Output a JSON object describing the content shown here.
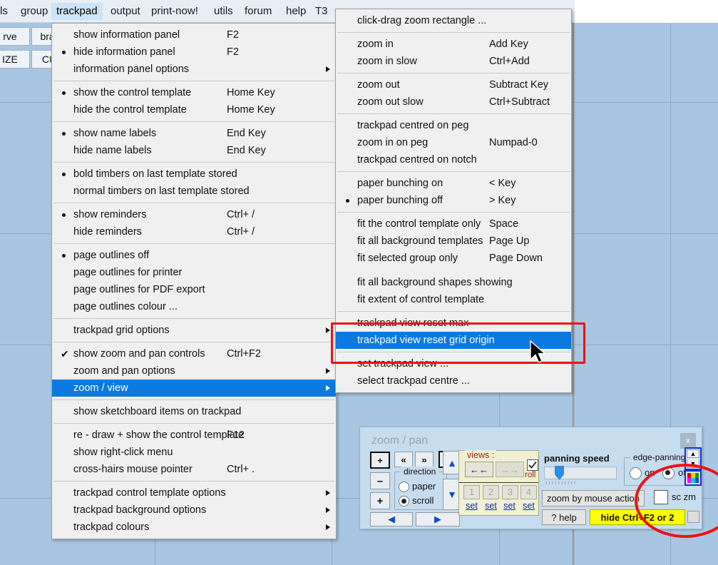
{
  "app": {
    "background_color": "#a8c6e2",
    "grid_line_color": "#8aa9c4"
  },
  "menubar": {
    "items": [
      {
        "label": "ls",
        "active": false
      },
      {
        "label": "group",
        "active": false
      },
      {
        "label": "trackpad",
        "active": true
      },
      {
        "label": "output",
        "active": false
      },
      {
        "label": "print-now!",
        "active": false
      },
      {
        "label": "utils",
        "active": false
      },
      {
        "label": "forum",
        "active": false
      },
      {
        "label": "help",
        "active": false
      },
      {
        "label": "T3",
        "active": false
      }
    ]
  },
  "toolbar": {
    "buttons": [
      {
        "label": "rve"
      },
      {
        "label": "branc"
      },
      {
        "label": "IZE"
      },
      {
        "label": "CUR"
      }
    ]
  },
  "trackpad_menu": {
    "title": "trackpad",
    "items": [
      {
        "type": "item",
        "label": "show information panel",
        "accel": "F2"
      },
      {
        "type": "item",
        "label": "hide information panel",
        "accel": "F2",
        "bullet": true
      },
      {
        "type": "item",
        "label": "information panel options",
        "accel": "",
        "submenu": true
      },
      {
        "type": "sep"
      },
      {
        "type": "item",
        "label": "show the control template",
        "accel": "Home Key",
        "bullet": true
      },
      {
        "type": "item",
        "label": "hide the control template",
        "accel": "Home Key"
      },
      {
        "type": "sep"
      },
      {
        "type": "item",
        "label": "show name labels",
        "accel": "End Key",
        "bullet": true
      },
      {
        "type": "item",
        "label": "hide name labels",
        "accel": "End Key"
      },
      {
        "type": "sep"
      },
      {
        "type": "item",
        "label": "bold timbers on last template stored",
        "accel": "",
        "bullet": true
      },
      {
        "type": "item",
        "label": "normal timbers on last template stored",
        "accel": ""
      },
      {
        "type": "sep"
      },
      {
        "type": "item",
        "label": "show reminders",
        "accel": "Ctrl+ /",
        "bullet": true
      },
      {
        "type": "item",
        "label": "hide reminders",
        "accel": "Ctrl+ /"
      },
      {
        "type": "sep"
      },
      {
        "type": "item",
        "label": "page outlines off",
        "accel": "",
        "bullet": true
      },
      {
        "type": "item",
        "label": "page outlines for printer",
        "accel": ""
      },
      {
        "type": "item",
        "label": "page outlines for PDF export",
        "accel": ""
      },
      {
        "type": "item",
        "label": "page outlines colour ...",
        "accel": ""
      },
      {
        "type": "sep"
      },
      {
        "type": "item",
        "label": "trackpad grid options",
        "accel": "",
        "submenu": true
      },
      {
        "type": "sep"
      },
      {
        "type": "item",
        "label": "show zoom and pan controls",
        "accel": "Ctrl+F2",
        "check": true
      },
      {
        "type": "item",
        "label": "zoom and pan options",
        "accel": "",
        "submenu": true
      },
      {
        "type": "item",
        "label": "zoom / view",
        "accel": "",
        "submenu": true,
        "selected": true
      },
      {
        "type": "sep"
      },
      {
        "type": "item",
        "label": "show sketchboard items on trackpad",
        "accel": ""
      },
      {
        "type": "sep"
      },
      {
        "type": "item",
        "label": "re - draw + show the control template",
        "accel": "F12"
      },
      {
        "type": "item",
        "label": "show right-click menu",
        "accel": ""
      },
      {
        "type": "item",
        "label": "cross-hairs mouse pointer",
        "accel": "Ctrl+ ."
      },
      {
        "type": "sep"
      },
      {
        "type": "item",
        "label": "trackpad control template options",
        "accel": "",
        "submenu": true
      },
      {
        "type": "item",
        "label": "trackpad background options",
        "accel": "",
        "submenu": true
      },
      {
        "type": "item",
        "label": "trackpad colours",
        "accel": "",
        "submenu": true
      }
    ]
  },
  "zoomview_menu": {
    "title": "zoom / view",
    "items": [
      {
        "type": "item",
        "label": "click-drag zoom rectangle ...",
        "accel": ""
      },
      {
        "type": "sep"
      },
      {
        "type": "item",
        "label": "zoom in",
        "accel": "Add Key"
      },
      {
        "type": "item",
        "label": "zoom in slow",
        "accel": "Ctrl+Add"
      },
      {
        "type": "sep"
      },
      {
        "type": "item",
        "label": "zoom out",
        "accel": "Subtract Key"
      },
      {
        "type": "item",
        "label": "zoom out slow",
        "accel": "Ctrl+Subtract"
      },
      {
        "type": "sep"
      },
      {
        "type": "item",
        "label": "trackpad centred on peg",
        "accel": ""
      },
      {
        "type": "item",
        "label": "zoom in on peg",
        "accel": "Numpad-0"
      },
      {
        "type": "item",
        "label": "trackpad centred on notch",
        "accel": ""
      },
      {
        "type": "sep"
      },
      {
        "type": "item",
        "label": "paper bunching on",
        "accel": "< Key"
      },
      {
        "type": "item",
        "label": "paper bunching off",
        "accel": "> Key",
        "bullet": true
      },
      {
        "type": "sep"
      },
      {
        "type": "item",
        "label": "fit the control template only",
        "accel": "Space"
      },
      {
        "type": "item",
        "label": "fit all background templates",
        "accel": "Page Up"
      },
      {
        "type": "item",
        "label": "fit selected group only",
        "accel": "Page Down"
      },
      {
        "type": "gap"
      },
      {
        "type": "item",
        "label": "fit all background shapes showing",
        "accel": ""
      },
      {
        "type": "item",
        "label": "fit extent of control template",
        "accel": ""
      },
      {
        "type": "sep"
      },
      {
        "type": "item",
        "label": "trackpad view reset max",
        "accel": ""
      },
      {
        "type": "item",
        "label": "trackpad view reset grid origin",
        "accel": "",
        "selected": true
      },
      {
        "type": "sep"
      },
      {
        "type": "item",
        "label": "set trackpad view ...",
        "accel": ""
      },
      {
        "type": "item",
        "label": "select trackpad centre ...",
        "accel": ""
      }
    ]
  },
  "zoom_pan_panel": {
    "title": "zoom / pan",
    "close_label": "x",
    "zoom_rect_label": "+",
    "prev_label": "«",
    "next_label": "»",
    "fit_width_label": "◀▶",
    "minus_label": "–",
    "plus_label": "+",
    "left_arrow_label": "◀",
    "right_arrow_label": "▶",
    "up_arrow_label": "▲",
    "down_arrow_label": "▼",
    "direction": {
      "legend": "direction",
      "options": [
        {
          "label": "paper",
          "selected": false
        },
        {
          "label": "scroll",
          "selected": true
        }
      ]
    },
    "views": {
      "legend": "views :",
      "back_label": "←←",
      "forward_label": "→→",
      "roll_label": "roll",
      "roll_checked": true,
      "slots": [
        "1",
        "2",
        "3",
        "4"
      ],
      "set_labels": [
        "set",
        "set",
        "set",
        "set"
      ]
    },
    "panning_speed": {
      "label": "panning speed",
      "value_percent": 18
    },
    "edge_panning": {
      "legend": "edge-panning",
      "options": [
        {
          "label": "on",
          "selected": false
        },
        {
          "label": "off",
          "selected": true
        }
      ]
    },
    "zoom_by_mouse_label": "zoom  by mouse action",
    "sc_zm": {
      "label": "sc zm",
      "checked": false
    },
    "help_label": "? help",
    "hide_label": "hide   Ctrl+F2  or  2"
  },
  "annotations": {
    "rect_color": "#ee1111",
    "ellipse_color": "#ee1111"
  }
}
